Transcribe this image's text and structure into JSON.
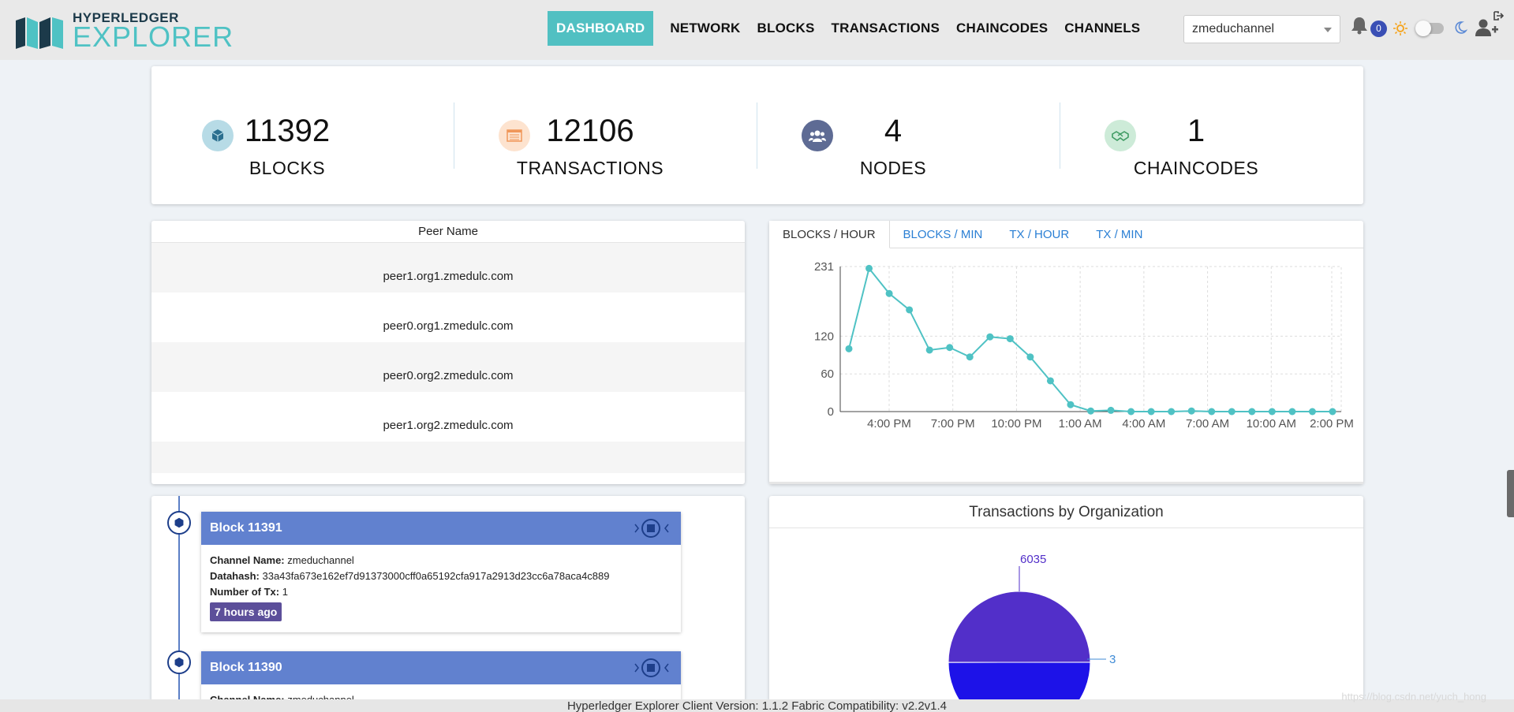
{
  "header": {
    "logo_top": "HYPERLEDGER",
    "logo_bottom": "EXPLORER",
    "nav": [
      "DASHBOARD",
      "NETWORK",
      "BLOCKS",
      "TRANSACTIONS",
      "CHAINCODES",
      "CHANNELS"
    ],
    "channel": "zmeduchannel",
    "notification_count": "0",
    "icons": [
      "bell-icon",
      "sun-icon",
      "theme-toggle",
      "moon-icon",
      "add-user-icon",
      "logout-icon"
    ]
  },
  "stats": [
    {
      "value": "11392",
      "label": "BLOCKS",
      "icon": "cube-icon",
      "color": "#b7dbe6"
    },
    {
      "value": "12106",
      "label": "TRANSACTIONS",
      "icon": "list-icon",
      "color": "#fde3cf"
    },
    {
      "value": "4",
      "label": "NODES",
      "icon": "users-icon",
      "color": "#5e6b94"
    },
    {
      "value": "1",
      "label": "CHAINCODES",
      "icon": "handshake-icon",
      "color": "#cdebd8"
    }
  ],
  "peers": {
    "header": "Peer Name",
    "rows": [
      "peer1.org1.zmedulc.com",
      "peer0.org1.zmedulc.com",
      "peer0.org2.zmedulc.com",
      "peer1.org2.zmedulc.com"
    ]
  },
  "chart_tabs": [
    "BLOCKS / HOUR",
    "BLOCKS / MIN",
    "TX / HOUR",
    "TX / MIN"
  ],
  "chart_data": [
    {
      "type": "line",
      "x_ticks": [
        "4:00 PM",
        "7:00 PM",
        "10:00 PM",
        "1:00 AM",
        "4:00 AM",
        "7:00 AM",
        "10:00 AM",
        "2:00 PM"
      ],
      "y_ticks": [
        0,
        60,
        120,
        231
      ],
      "ylim": [
        0,
        231
      ],
      "series": [
        {
          "values": [
            100,
            228,
            188,
            162,
            98,
            102,
            87,
            119,
            116,
            87,
            49,
            11,
            1,
            2,
            0,
            0,
            0,
            1,
            0,
            0,
            0,
            0,
            0,
            0,
            0
          ],
          "color": "#4fc2c4"
        }
      ],
      "grid": true
    },
    {
      "type": "pie",
      "title": "Transactions by Organization",
      "slices": [
        {
          "value": 6035,
          "label": "6035",
          "color": "#522fc9"
        },
        {
          "value": 6035,
          "label": "",
          "color": "#1d12e8"
        },
        {
          "value": 3,
          "label": "3",
          "color": "#3f8bd6"
        }
      ]
    }
  ],
  "blocks": [
    {
      "title": "Block 11391",
      "channel_label": "Channel Name:",
      "channel": "zmeduchannel",
      "datahash_label": "Datahash:",
      "datahash": "33a43fa673e162ef7d91373000cff0a65192cfa917a2913d23cc6a78aca4c889",
      "tx_label": "Number of Tx:",
      "tx": "1",
      "ago": "7 hours ago"
    },
    {
      "title": "Block 11390",
      "channel_label": "Channel Name:",
      "channel": "zmeduchannel"
    }
  ],
  "footer": "Hyperledger Explorer Client Version: 1.1.2    Fabric Compatibility: v2.2v1.4",
  "watermark": "https://blog.csdn.net/yuch_hong"
}
